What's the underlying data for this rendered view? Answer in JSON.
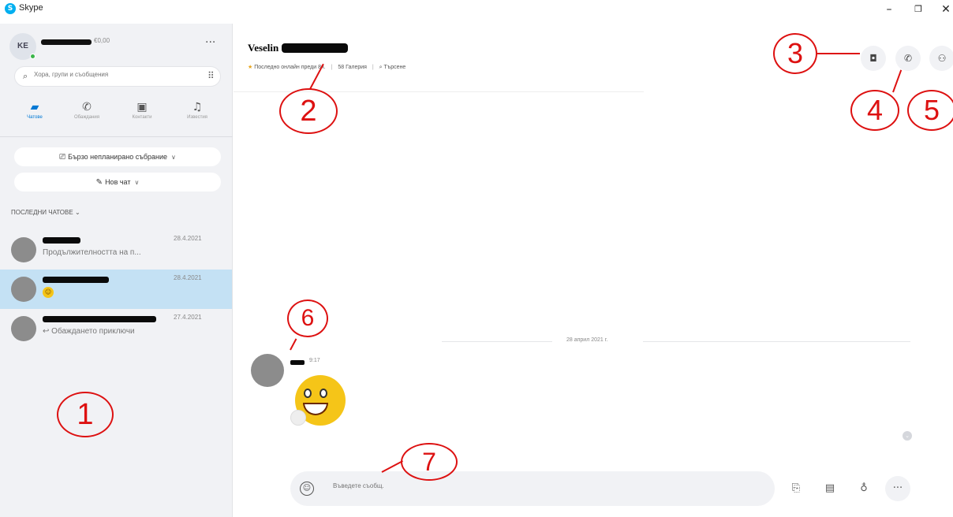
{
  "window": {
    "title": "Skype",
    "logo_letter": "S",
    "minimize": "–",
    "maximize": "❐",
    "close": "✕"
  },
  "sidebar": {
    "profile": {
      "initials": "KE",
      "balance": "€0,00",
      "more_icon": "more-icon"
    },
    "search": {
      "placeholder": "Хора, групи и съобщения",
      "icon": "search-icon",
      "dialpad_icon": "dialpad-icon"
    },
    "tabs": [
      {
        "label": "Чатове",
        "icon": "chat-icon",
        "active": true
      },
      {
        "label": "Обаждания",
        "icon": "phone-icon"
      },
      {
        "label": "Контакти",
        "icon": "contacts-icon"
      },
      {
        "label": "Известия",
        "icon": "bell-icon"
      }
    ],
    "meet_now": "Бързо неплани­рано събрание",
    "new_chat": "Нов чат",
    "recent_header": "ПОСЛЕДНИ ЧАТОВЕ",
    "chats": [
      {
        "date": "28.4.2021",
        "preview": "Продължителността на п...",
        "selected": false
      },
      {
        "date": "28.4.2021",
        "preview": "",
        "selected": true,
        "preview_emoji": "laugh-emoji"
      },
      {
        "date": "27.4.2021",
        "preview": "Обаждането приключи",
        "selected": false
      }
    ]
  },
  "conversation": {
    "contact_name": "Veselin",
    "status": "Последно онлайн преди 8ч.",
    "gallery": "Галерия",
    "gallery_count": "58",
    "search_label": "Търсене",
    "date_separator": "28 април 2021 г.",
    "message_time": "9:17",
    "message_emoji": "laughing-smiley-emoji",
    "composer_placeholder": "Въведете съобщ.",
    "header_buttons": {
      "video": "video-call-icon",
      "audio": "audio-call-icon",
      "add": "add-people-icon"
    },
    "tools": [
      "gallery-icon",
      "contact-card-icon",
      "microphone-icon",
      "more-icon"
    ]
  },
  "annotations": [
    "1",
    "2",
    "3",
    "4",
    "5",
    "6",
    "7"
  ],
  "colors": {
    "accent": "#0078d4",
    "selected_chat": "#c4e1f4",
    "annotation": "#dd1111",
    "online": "#3bb54a",
    "emoji": "#f5c518"
  }
}
